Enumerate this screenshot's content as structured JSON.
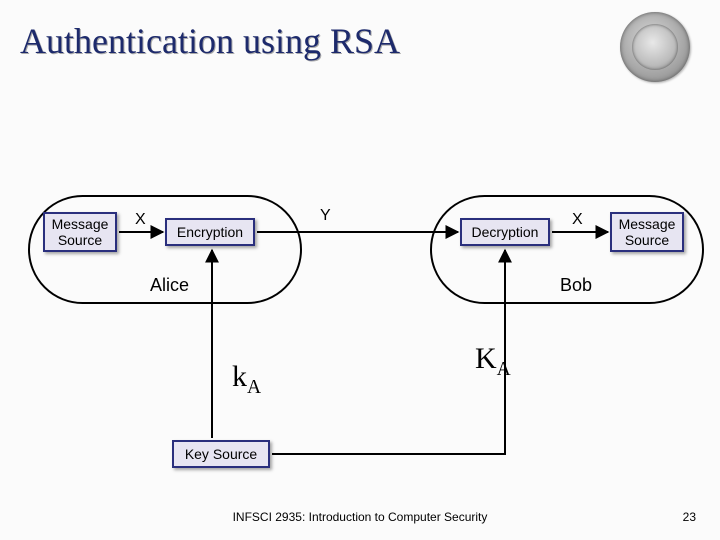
{
  "title": "Authentication using RSA",
  "seal": {
    "name": "university-seal"
  },
  "labels": {
    "X_left": "X",
    "Y": "Y",
    "X_right": "X"
  },
  "parties": {
    "alice": "Alice",
    "bob": "Bob"
  },
  "keys": {
    "private": {
      "base": "k",
      "sub": "A"
    },
    "public": {
      "base": "K",
      "sub": "A"
    }
  },
  "boxes": {
    "source_left": "Message\nSource",
    "encryption": "Encryption",
    "decryption": "Decryption",
    "source_right": "Message\nSource",
    "key_source": "Key Source"
  },
  "footer": {
    "course": "INFSCI 2935: Introduction to Computer Security",
    "page": "23"
  }
}
